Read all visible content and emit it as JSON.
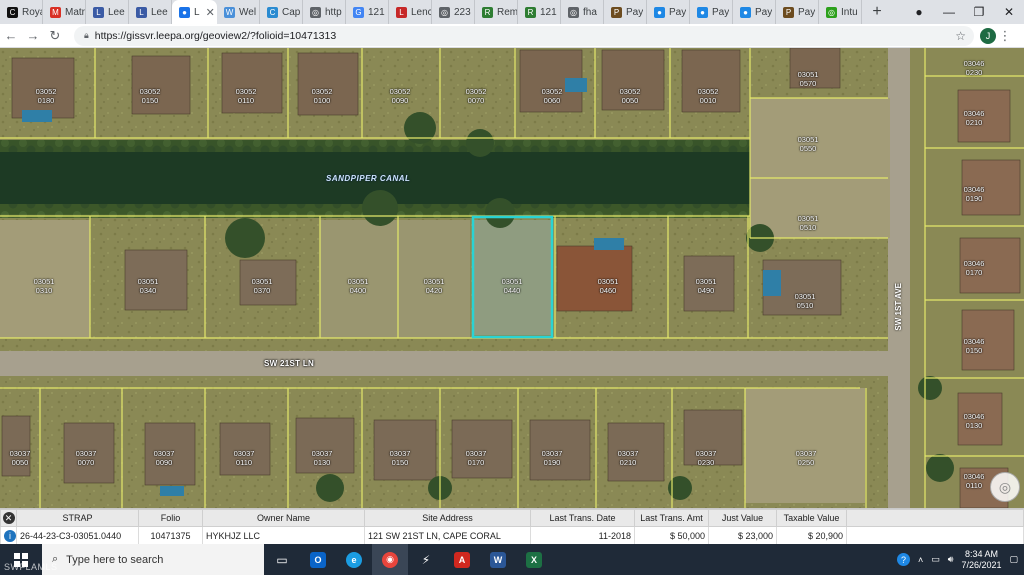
{
  "browser": {
    "tabs": [
      {
        "label": "Roya",
        "color": "#111111",
        "glyph": "C"
      },
      {
        "label": "Matr",
        "color": "#d93025",
        "glyph": "M"
      },
      {
        "label": "Lee",
        "color": "#3b5ba5",
        "glyph": "L"
      },
      {
        "label": "Lee",
        "color": "#3b5ba5",
        "glyph": "L"
      },
      {
        "label": "L",
        "color": "#1a73e8",
        "glyph": "●",
        "active": true
      },
      {
        "label": "Wel",
        "color": "#4a90d9",
        "glyph": "W"
      },
      {
        "label": "Cap",
        "color": "#2a8bd1",
        "glyph": "C"
      },
      {
        "label": "http",
        "color": "#5f6368",
        "glyph": "◎"
      },
      {
        "label": "121",
        "color": "#4285f4",
        "glyph": "G"
      },
      {
        "label": "Lenc",
        "color": "#c62828",
        "glyph": "L"
      },
      {
        "label": "223",
        "color": "#5f6368",
        "glyph": "◎"
      },
      {
        "label": "Rem",
        "color": "#2e7d32",
        "glyph": "R"
      },
      {
        "label": "121",
        "color": "#2e7d32",
        "glyph": "R"
      },
      {
        "label": "fha",
        "color": "#5f6368",
        "glyph": "◎"
      },
      {
        "label": "Pay",
        "color": "#6d4c1f",
        "glyph": "P"
      },
      {
        "label": "Pay",
        "color": "#1e88e5",
        "glyph": "●"
      },
      {
        "label": "Pay",
        "color": "#1e88e5",
        "glyph": "●"
      },
      {
        "label": "Pay",
        "color": "#1e88e5",
        "glyph": "●"
      },
      {
        "label": "Pay",
        "color": "#6d4c1f",
        "glyph": "P"
      },
      {
        "label": "Intu",
        "color": "#2ca01c",
        "glyph": "◎"
      }
    ],
    "new_tab_glyph": "+",
    "url": "https://gissvr.leepa.org/geoview2/?folioid=10471313",
    "profile_initial": "J"
  },
  "map": {
    "canal_label": "SANDPIPER CANAL",
    "street_label": "SW 21ST LN",
    "avenue_label": "SW 1ST AVE",
    "parcels": [
      {
        "id": "03052\n0180"
      },
      {
        "id": "03052\n0150"
      },
      {
        "id": "03052\n0110"
      },
      {
        "id": "03052\n0100"
      },
      {
        "id": "03052\n0090"
      },
      {
        "id": "03052\n0070"
      },
      {
        "id": "03052\n0060"
      },
      {
        "id": "03052\n0050"
      },
      {
        "id": "03052\n0010"
      },
      {
        "id": "03051\n0570"
      },
      {
        "id": "03051\n0550"
      },
      {
        "id": "03051\n0510"
      },
      {
        "id": "03051\n0310"
      },
      {
        "id": "03051\n0340"
      },
      {
        "id": "03051\n0370"
      },
      {
        "id": "03051\n0400"
      },
      {
        "id": "03051\n0420"
      },
      {
        "id": "03051\n0440"
      },
      {
        "id": "03051\n0460"
      },
      {
        "id": "03051\n0490"
      },
      {
        "id": "03051\n0510"
      },
      {
        "id": "03037\n0050"
      },
      {
        "id": "03037\n0070"
      },
      {
        "id": "03037\n0090"
      },
      {
        "id": "03037\n0110"
      },
      {
        "id": "03037\n0130"
      },
      {
        "id": "03037\n0150"
      },
      {
        "id": "03037\n0170"
      },
      {
        "id": "03037\n0190"
      },
      {
        "id": "03037\n0210"
      },
      {
        "id": "03037\n0230"
      },
      {
        "id": "03037\n0250"
      },
      {
        "id": "03046\n0230"
      },
      {
        "id": "03046\n0210"
      },
      {
        "id": "03046\n0190"
      },
      {
        "id": "03046\n0170"
      },
      {
        "id": "03046\n0150"
      },
      {
        "id": "03046\n0130"
      },
      {
        "id": "03046\n0110"
      }
    ]
  },
  "info_table": {
    "headers": [
      "STRAP",
      "Folio",
      "Owner Name",
      "Site Address",
      "Last Trans. Date",
      "Last Trans. Amt",
      "Just Value",
      "Taxable Value"
    ],
    "row": [
      "26-44-23-C3-03051.0440",
      "10471375",
      "HYKHJZ LLC",
      "121 SW 21ST LN, CAPE CORAL",
      "11-2018",
      "$ 50,000",
      "$ 23,000",
      "$ 20,900"
    ]
  },
  "taskbar": {
    "search_placeholder": "Type here to search",
    "time": "8:34 AM",
    "date": "7/26/2021"
  },
  "watermark": "SWFLAMLS",
  "colors": {
    "parcel_line": "#e4e86a",
    "selected_parcel": "#2ad3d3",
    "canal": "#1e3a22"
  }
}
